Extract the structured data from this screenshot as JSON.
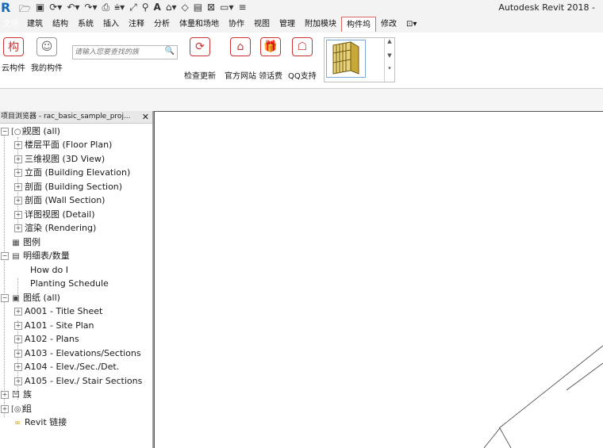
{
  "app_title": "Autodesk Revit 2018 -",
  "tabs": [
    "文件",
    "建筑",
    "结构",
    "系统",
    "插入",
    "注释",
    "分析",
    "体量和场地",
    "协作",
    "视图",
    "管理",
    "附加模块",
    "构件坞",
    "修改",
    "⊡▾"
  ],
  "ribbon": {
    "cloud_component": "云构件",
    "my_component": "我的构件",
    "search_placeholder": "请输入您要查找的族",
    "check_update": "检查更新",
    "official_site": "官方网站",
    "get_coins": "领话费",
    "qq_support": "QQ支持"
  },
  "browser": {
    "title": "项目浏览器 - rac_basic_sample_proj...",
    "nodes": [
      "视图 (all)",
      "楼层平面 (Floor Plan)",
      "三维视图 (3D View)",
      "立面 (Building Elevation)",
      "剖面 (Building Section)",
      "剖面 (Wall Section)",
      "详图视图 (Detail)",
      "渲染 (Rendering)",
      "图例",
      "明细表/数量",
      "How do I",
      "Planting Schedule",
      "图纸 (all)",
      "A001 - Title Sheet",
      "A101 - Site Plan",
      "A102 - Plans",
      "A103 - Elevations/Sections",
      "A104 - Elev./Sec./Det.",
      "A105 - Elev./ Stair Sections",
      "族",
      "组",
      "Revit 链接"
    ]
  },
  "colors": {
    "accent": "#cc3333",
    "selection": "#cde3f7",
    "revit_blue": "#1769b5"
  }
}
